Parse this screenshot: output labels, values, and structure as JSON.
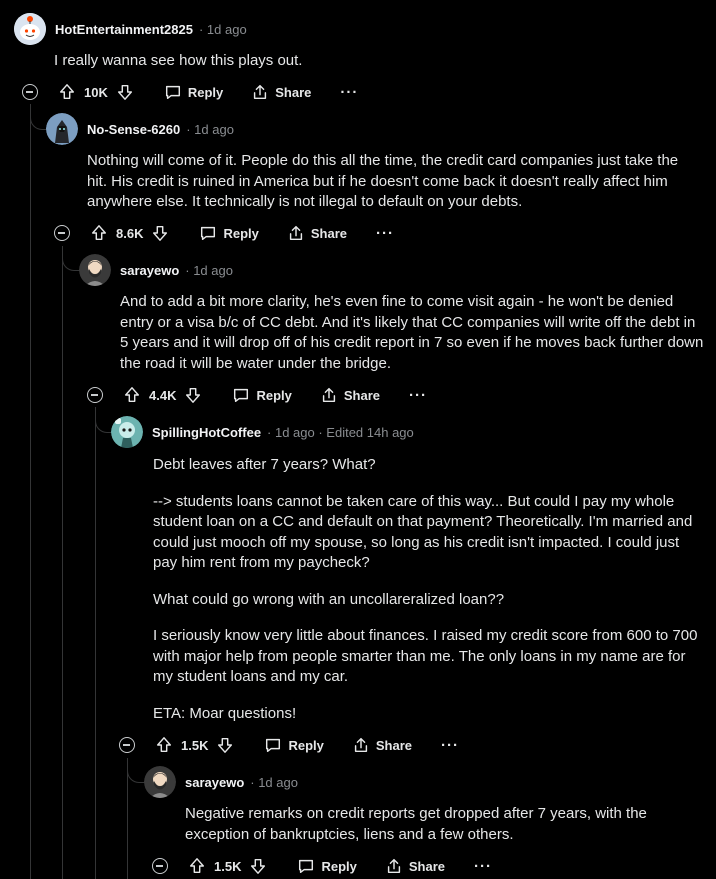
{
  "comments": [
    {
      "author": "HotEntertainment2825",
      "meta": "· 1d ago",
      "body": [
        "I really wanna see how this plays out."
      ],
      "votes": "10K",
      "reply_label": "Reply",
      "share_label": "Share",
      "more_label": "···",
      "avatar_color": "#d7e2f0"
    },
    {
      "author": "No-Sense-6260",
      "meta": "· 1d ago",
      "body": [
        "Nothing will come of it. People do this all the time, the credit card companies just take the hit. His credit is ruined in America but if he doesn't come back it doesn't really affect him anywhere else. It technically is not illegal to default on your debts."
      ],
      "votes": "8.6K",
      "reply_label": "Reply",
      "share_label": "Share",
      "more_label": "···",
      "avatar_color": "#6d8fb0"
    },
    {
      "author": "sarayewo",
      "meta": "· 1d ago",
      "body": [
        "And to add a bit more clarity, he's even fine to come visit again - he won't be denied entry or a visa b/c of CC debt. And it's likely that CC companies will write off the debt in 5 years and it will drop off of his credit report in 7 so even if he moves back further down the road it will be water under the bridge."
      ],
      "votes": "4.4K",
      "reply_label": "Reply",
      "share_label": "Share",
      "more_label": "···",
      "avatar_color": "#3b3b3b"
    },
    {
      "author": "SpillingHotCoffee",
      "meta": "· 1d ago · Edited 14h ago",
      "body": [
        "Debt leaves after 7 years? What?",
        "--> students loans cannot be taken care of this way... But could I pay my whole student loan on a CC and default on that payment? Theoretically. I'm married and could just mooch off my spouse, so long as his credit isn't impacted. I could just pay him rent from my paycheck?",
        "What could go wrong with an uncollareralized loan??",
        "I seriously know very little about finances. I raised my credit score from 600 to 700 with major help from people smarter than me. The only loans in my name are for my student loans and my car.",
        "ETA: Moar questions!"
      ],
      "votes": "1.5K",
      "reply_label": "Reply",
      "share_label": "Share",
      "more_label": "···",
      "avatar_color": "#5aa3a0"
    },
    {
      "author": "sarayewo",
      "meta": "· 1d ago",
      "body": [
        "Negative remarks on credit reports get dropped after 7 years, with the exception of bankruptcies, liens and a few others."
      ],
      "votes": "1.5K",
      "reply_label": "Reply",
      "share_label": "Share",
      "more_label": "···",
      "avatar_color": "#3b3b3b"
    }
  ]
}
